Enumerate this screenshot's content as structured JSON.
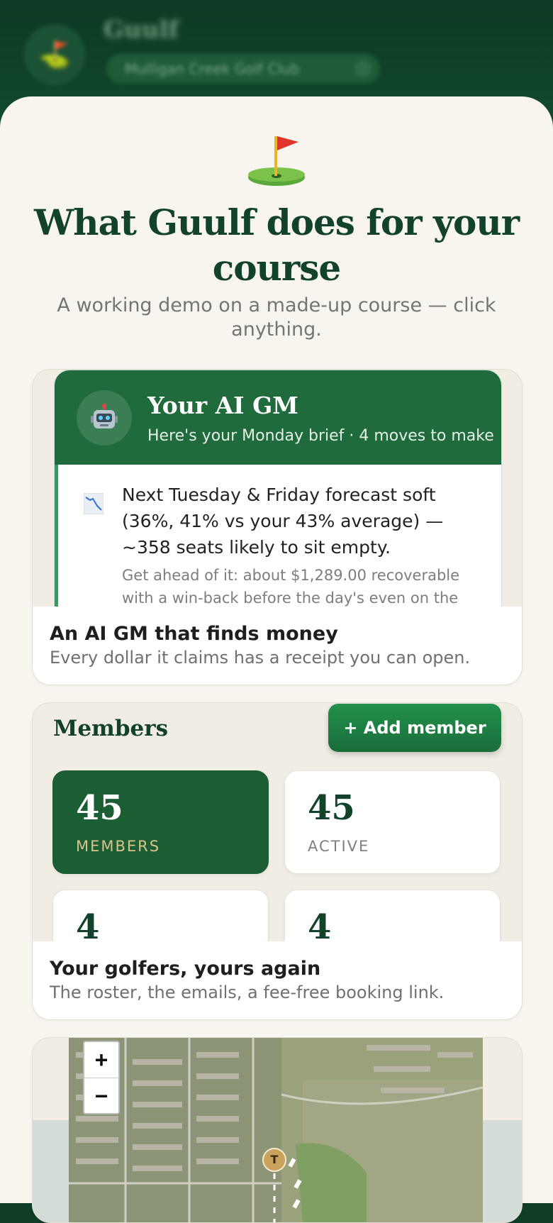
{
  "background_header": {
    "app_title": "Guulf",
    "club_selector": "Mulligan Creek Golf Club"
  },
  "hero": {
    "icon": "golf-flag-icon",
    "title": "What Guulf does for your course",
    "subtitle": "A working demo on a made-up course — click anything."
  },
  "ai_gm_card": {
    "panel_title": "Your AI GM",
    "panel_subtitle": "Here's your Monday brief · 4 moves to make",
    "avatar_icon": "robot-icon",
    "insight_icon": "chart-decreasing-icon",
    "insight_text": "Next Tuesday & Friday forecast soft (36%, 41% vs your 43% average) — ~358 seats likely to sit empty.",
    "insight_note": "Get ahead of it: about $1,289.00 recoverable with a win-back before the day's even on the",
    "caption_title": "An AI GM that finds money",
    "caption_subtitle": "Every dollar it claims has a receipt you can open."
  },
  "members_card": {
    "title": "Members",
    "add_button": "+ Add member",
    "stats": [
      {
        "value": "45",
        "label": "MEMBERS"
      },
      {
        "value": "45",
        "label": "ACTIVE"
      },
      {
        "value": "4",
        "label": ""
      },
      {
        "value": "4",
        "label": ""
      }
    ],
    "caption_title": "Your golfers, yours again",
    "caption_subtitle": "The roster, the emails, a fee-free booking link."
  },
  "map_card": {
    "zoom_in": "+",
    "zoom_out": "−",
    "tee_marker": "T"
  },
  "colors": {
    "brand_dark_green": "#12422a",
    "brand_green": "#1f6b3b",
    "accent_green": "#2aa35a",
    "sheet_bg": "#f8f5ef",
    "gold_label": "#d8c38a"
  }
}
